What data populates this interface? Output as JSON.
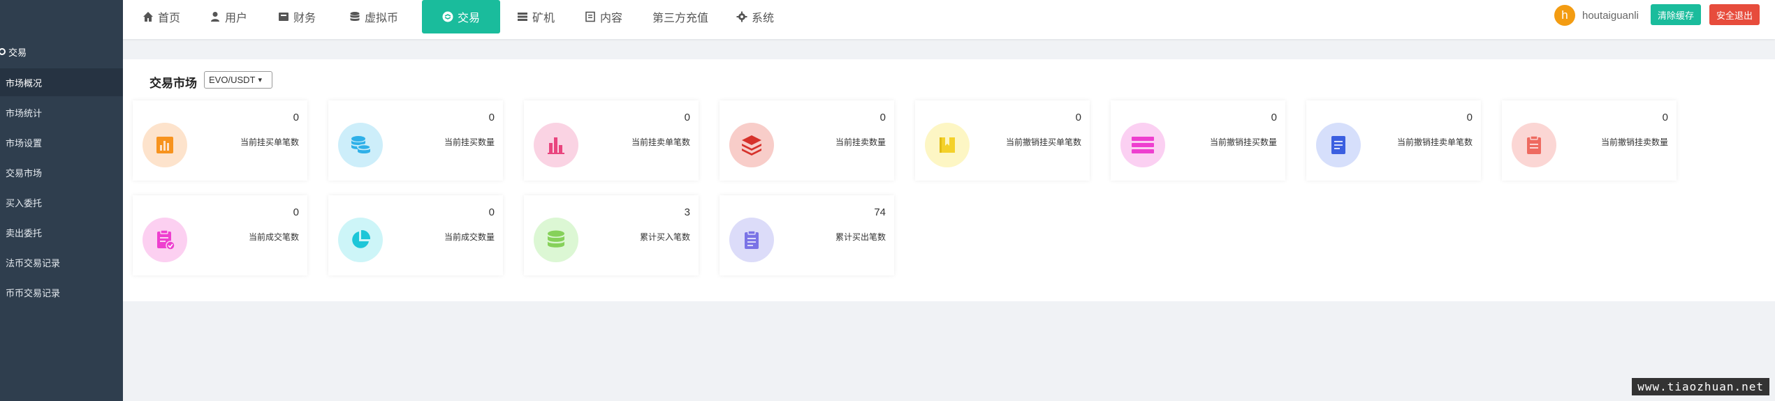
{
  "sidebar": {
    "title": "交易",
    "items": [
      {
        "label": "市场概况",
        "active": true
      },
      {
        "label": "市场统计"
      },
      {
        "label": "市场设置"
      },
      {
        "label": "交易市场"
      },
      {
        "label": "买入委托"
      },
      {
        "label": "卖出委托"
      },
      {
        "label": "法币交易记录"
      },
      {
        "label": "币币交易记录"
      }
    ]
  },
  "nav": {
    "items": [
      {
        "label": "首页",
        "icon": "home-icon"
      },
      {
        "label": "用户",
        "icon": "user-icon"
      },
      {
        "label": "财务",
        "icon": "wallet-icon"
      },
      {
        "label": "虚拟币",
        "icon": "database-icon"
      },
      {
        "label": "交易",
        "icon": "exchange-icon",
        "active": true
      },
      {
        "label": "矿机",
        "icon": "grid-icon"
      },
      {
        "label": "内容",
        "icon": "document-icon"
      },
      {
        "label": "第三方充值",
        "icon": ""
      },
      {
        "label": "系统",
        "icon": "gear-icon"
      }
    ],
    "accent": "#1abc9c"
  },
  "user": {
    "avatar_letter": "h",
    "name": "houtaiguanli"
  },
  "buttons": {
    "clear_cache": "清除缓存",
    "logout": "安全退出"
  },
  "market": {
    "title": "交易市场",
    "selected_pair": "EVO/USDT"
  },
  "cards": [
    {
      "value": "0",
      "label": "当前挂买单笔数",
      "icon": "bar-chart-icon",
      "bg": "#fde3cc",
      "fg": "#f7931e"
    },
    {
      "value": "0",
      "label": "当前挂买数量",
      "icon": "coins-icon",
      "bg": "#cdeefa",
      "fg": "#2fb0e8"
    },
    {
      "value": "0",
      "label": "当前挂卖单笔数",
      "icon": "column-chart-icon",
      "bg": "#fad3e3",
      "fg": "#e9457e"
    },
    {
      "value": "0",
      "label": "当前挂卖数量",
      "icon": "layers-icon",
      "bg": "#f8cdc9",
      "fg": "#d6322b"
    },
    {
      "value": "0",
      "label": "当前撤销挂买单笔数",
      "icon": "book-icon",
      "bg": "#fdf6c4",
      "fg": "#f4d12a"
    },
    {
      "value": "0",
      "label": "当前撤销挂买数量",
      "icon": "list-icon",
      "bg": "#fbd0f2",
      "fg": "#ee3fcf"
    },
    {
      "value": "0",
      "label": "当前撤销挂卖单笔数",
      "icon": "file-icon",
      "bg": "#d6dffb",
      "fg": "#3b5fe0"
    },
    {
      "value": "0",
      "label": "当前撤销挂卖数量",
      "icon": "clipboard-icon",
      "bg": "#fbd6d4",
      "fg": "#ee6a60"
    },
    {
      "value": "0",
      "label": "当前成交笔数",
      "icon": "clipboard-check-icon",
      "bg": "#fcd0f1",
      "fg": "#ee3fcf"
    },
    {
      "value": "0",
      "label": "当前成交数量",
      "icon": "pie-chart-icon",
      "bg": "#cdf5f8",
      "fg": "#1dc6d8"
    },
    {
      "value": "3",
      "label": "累计买入笔数",
      "icon": "database-icon",
      "bg": "#dcf7d4",
      "fg": "#86d15a"
    },
    {
      "value": "74",
      "label": "累计买出笔数",
      "icon": "clipboard-icon",
      "bg": "#dcdcf9",
      "fg": "#7a73e6"
    }
  ],
  "watermark": "www.tiaozhuan.net"
}
